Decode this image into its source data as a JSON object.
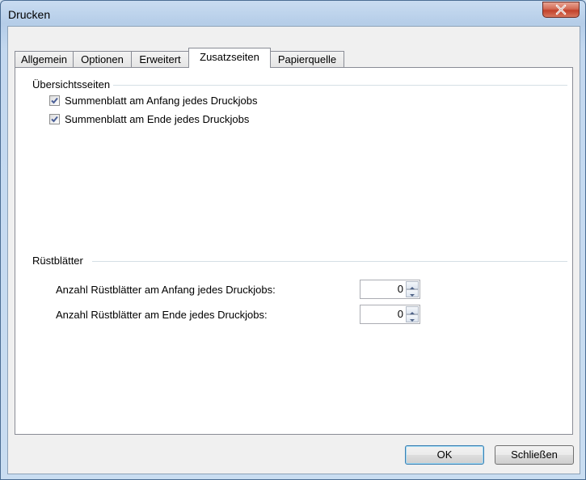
{
  "window": {
    "title": "Drucken"
  },
  "tabs": [
    {
      "label": "Allgemein"
    },
    {
      "label": "Optionen"
    },
    {
      "label": "Erweitert"
    },
    {
      "label": "Zusatzseiten"
    },
    {
      "label": "Papierquelle"
    }
  ],
  "active_tab": "Zusatzseiten",
  "overview": {
    "title": "Übersichtsseiten",
    "items": [
      {
        "label": "Summenblatt am Anfang jedes Druckjobs",
        "checked": true
      },
      {
        "label": "Summenblatt am Ende jedes Druckjobs",
        "checked": true
      }
    ]
  },
  "setup": {
    "title": "Rüstblätter",
    "fields": [
      {
        "label": "Anzahl Rüstblätter am Anfang jedes Druckjobs:",
        "value": "0"
      },
      {
        "label": "Anzahl Rüstblätter am Ende jedes Druckjobs:",
        "value": "0"
      }
    ]
  },
  "buttons": {
    "ok": "OK",
    "close": "Schließen"
  }
}
